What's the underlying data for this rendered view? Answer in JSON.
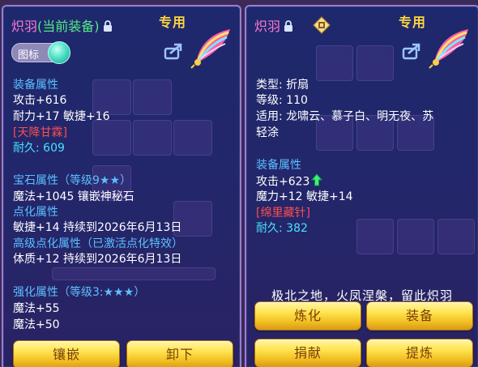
{
  "left": {
    "item_name": "炽羽",
    "equipped_tag": "(当前装备)",
    "special_label": "专用",
    "toggle_label": "图标",
    "equip_attr_title": "装备属性",
    "attack": "攻击+616",
    "stamina_agility": "耐力+17 敏捷+16",
    "gem_tag": "[天降甘霖]",
    "durability_label": "耐久:",
    "durability_value": "609",
    "gem_attr_title": "宝石属性（等级9★★）",
    "magic_gem": "魔法+1045 镶嵌神秘石",
    "point_attr_title": "点化属性",
    "point_agility": "敏捷+14 持续到2026年6月13日",
    "adv_point_title": "高级点化属性（已激活点化特效）",
    "adv_constitution": "体质+12 持续到2026年6月13日",
    "strengthen_title": "强化属性（等级3:★★★）",
    "magic_55": "魔法+55",
    "magic_50": "魔法+50",
    "btn_inlay": "镶嵌",
    "btn_unequip": "卸下"
  },
  "right": {
    "item_name": "炽羽",
    "special_label": "专用",
    "type_line": "类型: 折扇",
    "level_line": "等级: 110",
    "fit_line1": "适用: 龙啸云、慕子白、明无夜、苏",
    "fit_line2": "轻涂",
    "equip_attr_title": "装备属性",
    "attack": "攻击+623",
    "magic_agility": "魔力+12 敏捷+14",
    "gem_tag": "[绵里藏针]",
    "durability_label": "耐久:",
    "durability_value": "382",
    "quote": "极北之地，火凤涅槃，留此炽羽",
    "btn_refine": "炼化",
    "btn_equip": "装备",
    "btn_donate": "捐献",
    "btn_extract": "提炼"
  },
  "colors": {
    "heading_blue": "#5bc0ff",
    "pink_name": "#ff7ad6",
    "equipped_green": "#54ea86",
    "special_gold": "#ffd640",
    "gem_red": "#ff4d4d",
    "durability_cyan": "#46e2ff"
  }
}
